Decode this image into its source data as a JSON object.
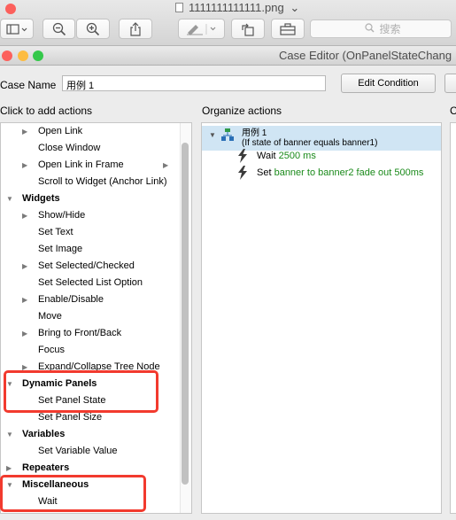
{
  "preview_window": {
    "file_title": "1111111111111.png",
    "title_chevron": "⌄",
    "search_placeholder": "搜索"
  },
  "editor_window": {
    "title": "Case Editor (OnPanelStateChang",
    "case_name_label": "Case Name",
    "case_name_value": "用例 1",
    "edit_condition_label": "Edit Condition"
  },
  "left_column": {
    "header": "Click to add actions",
    "items": [
      {
        "label": "Open Link",
        "level": 1,
        "expander": true,
        "submenu": false,
        "bold": false
      },
      {
        "label": "Close Window",
        "level": 1,
        "expander": false,
        "submenu": false,
        "bold": false
      },
      {
        "label": "Open Link in Frame",
        "level": 1,
        "expander": true,
        "submenu": true,
        "bold": false
      },
      {
        "label": "Scroll to Widget (Anchor Link)",
        "level": 1,
        "expander": false,
        "submenu": false,
        "bold": false
      },
      {
        "label": "Widgets",
        "level": 0,
        "expander": true,
        "open": true,
        "submenu": false,
        "bold": true
      },
      {
        "label": "Show/Hide",
        "level": 1,
        "expander": true,
        "submenu": false,
        "bold": false
      },
      {
        "label": "Set Text",
        "level": 1,
        "expander": false,
        "submenu": false,
        "bold": false
      },
      {
        "label": "Set Image",
        "level": 1,
        "expander": false,
        "submenu": false,
        "bold": false
      },
      {
        "label": "Set Selected/Checked",
        "level": 1,
        "expander": true,
        "submenu": false,
        "bold": false
      },
      {
        "label": "Set Selected List Option",
        "level": 1,
        "expander": false,
        "submenu": false,
        "bold": false
      },
      {
        "label": "Enable/Disable",
        "level": 1,
        "expander": true,
        "submenu": false,
        "bold": false
      },
      {
        "label": "Move",
        "level": 1,
        "expander": false,
        "submenu": false,
        "bold": false
      },
      {
        "label": "Bring to Front/Back",
        "level": 1,
        "expander": true,
        "submenu": false,
        "bold": false
      },
      {
        "label": "Focus",
        "level": 1,
        "expander": false,
        "submenu": false,
        "bold": false
      },
      {
        "label": "Expand/Collapse Tree Node",
        "level": 1,
        "expander": true,
        "submenu": false,
        "bold": false
      },
      {
        "label": "Dynamic Panels",
        "level": 0,
        "expander": true,
        "open": true,
        "submenu": false,
        "bold": true
      },
      {
        "label": "Set Panel State",
        "level": 1,
        "expander": false,
        "submenu": false,
        "bold": false
      },
      {
        "label": "Set Panel Size",
        "level": 1,
        "expander": false,
        "submenu": false,
        "bold": false
      },
      {
        "label": "Variables",
        "level": 0,
        "expander": true,
        "open": true,
        "submenu": false,
        "bold": true
      },
      {
        "label": "Set Variable Value",
        "level": 1,
        "expander": false,
        "submenu": false,
        "bold": false
      },
      {
        "label": "Repeaters",
        "level": 0,
        "expander": true,
        "open": false,
        "submenu": false,
        "bold": true
      },
      {
        "label": "Miscellaneous",
        "level": 0,
        "expander": true,
        "open": true,
        "submenu": false,
        "bold": true
      },
      {
        "label": "Wait",
        "level": 1,
        "expander": false,
        "submenu": false,
        "bold": false
      }
    ],
    "highlight_color": "#f23a2e"
  },
  "middle_column": {
    "header": "Organize actions",
    "case": {
      "name": "用例 1",
      "condition": "(If state of banner equals banner1)"
    },
    "actions": [
      {
        "verb": "Wait",
        "detail": "2500 ms"
      },
      {
        "verb": "Set",
        "detail": "banner to banner2 fade out 500ms"
      }
    ],
    "selection_color": "#d0e5f4",
    "detail_color": "#1a8a1a"
  },
  "right_column": {
    "header_partial": "C"
  },
  "icons": {
    "traffic_lights": [
      "#fc605c",
      "#fdbc40",
      "#34c84a"
    ],
    "toolbar": [
      "sidebar-icon",
      "zoom-out-icon",
      "zoom-in-icon",
      "share-icon",
      "annotate-icon",
      "rotate-icon",
      "toolbox-icon",
      "search-icon"
    ],
    "action": "lightning-icon",
    "case": "case-tree-icon"
  }
}
